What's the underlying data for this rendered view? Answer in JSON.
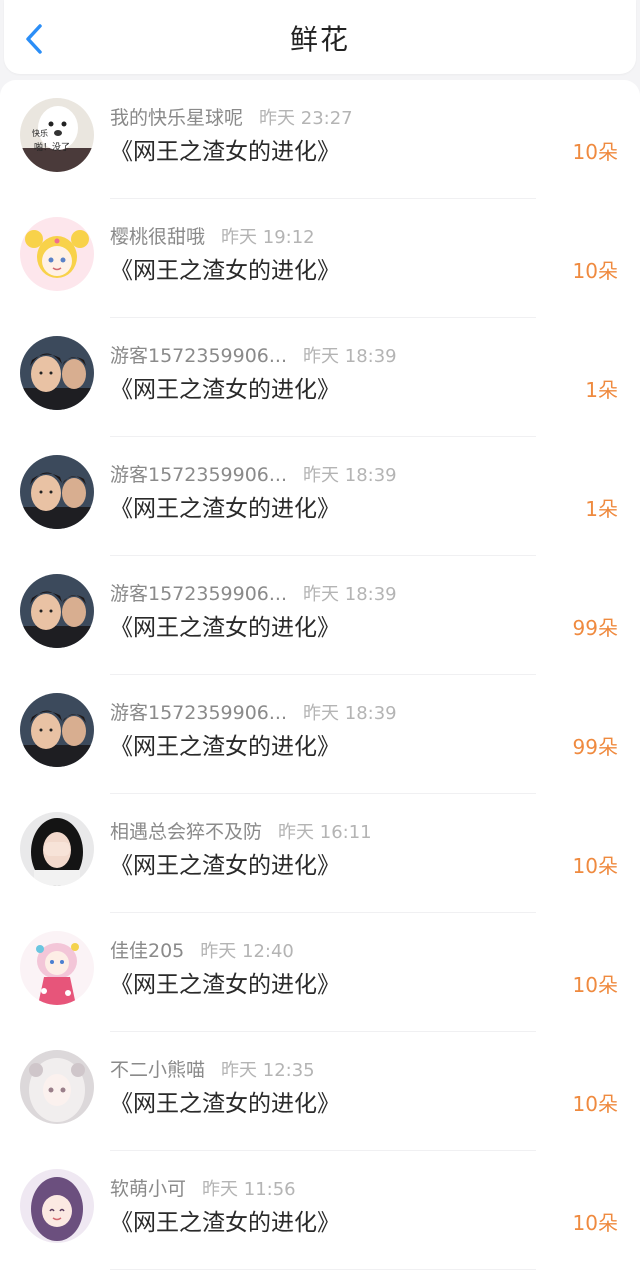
{
  "header": {
    "title": "鲜花"
  },
  "records": [
    {
      "name": "我的快乐星球呢",
      "time": "昨天 23:27",
      "book": "《网王之渣女的进化》",
      "amount": "10朵",
      "avatar": "meme-dog-avatar",
      "avatar_caption_1": "快乐",
      "avatar_caption_2": "啪！没了"
    },
    {
      "name": "樱桃很甜哦",
      "time": "昨天 19:12",
      "book": "《网王之渣女的进化》",
      "amount": "10朵",
      "avatar": "sailor-moon-avatar"
    },
    {
      "name": "游客1572359906...",
      "time": "昨天 18:39",
      "book": "《网王之渣女的进化》",
      "amount": "1朵",
      "avatar": "two-boys-photo-avatar"
    },
    {
      "name": "游客1572359906...",
      "time": "昨天 18:39",
      "book": "《网王之渣女的进化》",
      "amount": "1朵",
      "avatar": "two-boys-photo-avatar"
    },
    {
      "name": "游客1572359906...",
      "time": "昨天 18:39",
      "book": "《网王之渣女的进化》",
      "amount": "99朵",
      "avatar": "two-boys-photo-avatar"
    },
    {
      "name": "游客1572359906...",
      "time": "昨天 18:39",
      "book": "《网王之渣女的进化》",
      "amount": "99朵",
      "avatar": "two-boys-photo-avatar"
    },
    {
      "name": "相遇总会猝不及防",
      "time": "昨天 16:11",
      "book": "《网王之渣女的进化》",
      "amount": "10朵",
      "avatar": "girl-covering-face-avatar"
    },
    {
      "name": "佳佳205",
      "time": "昨天 12:40",
      "book": "《网王之渣女的进化》",
      "amount": "10朵",
      "avatar": "anime-princess-avatar"
    },
    {
      "name": "不二小熊喵",
      "time": "昨天 12:35",
      "book": "《网王之渣女的进化》",
      "amount": "10朵",
      "avatar": "anime-white-hair-girl-avatar"
    },
    {
      "name": "软萌小可",
      "time": "昨天 11:56",
      "book": "《网王之渣女的进化》",
      "amount": "10朵",
      "avatar": "anime-purple-hair-girl-avatar"
    }
  ],
  "colors": {
    "accent": "#2b8ef7",
    "amount": "#ef8a3f",
    "name": "#8a8a8a",
    "time": "#b4b4b4"
  }
}
